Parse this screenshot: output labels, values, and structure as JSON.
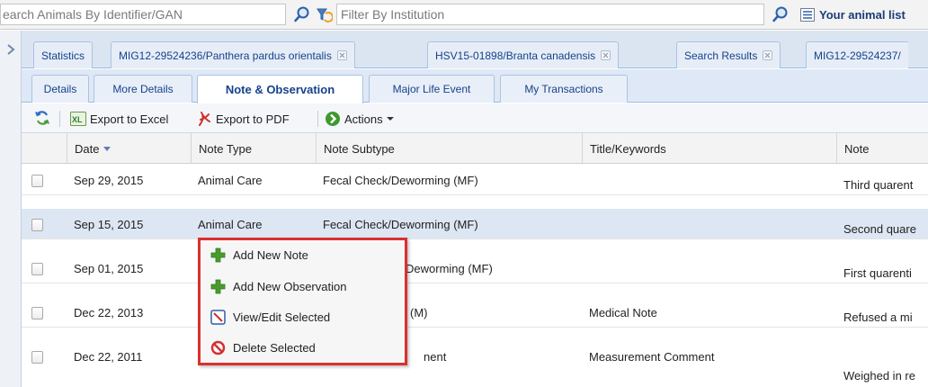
{
  "topbar": {
    "search_value": "earch Animals By Identifier/GAN",
    "filter_value": "Filter By Institution",
    "animal_list_label": "Your animal list"
  },
  "workspace_tabs": [
    {
      "label": "Statistics",
      "closable": false
    },
    {
      "label": "MIG12-29524236/Panthera pardus orientalis",
      "closable": true
    },
    {
      "label": "HSV15-01898/Branta canadensis",
      "closable": true
    },
    {
      "label": "Search Results",
      "closable": true
    },
    {
      "label": "MIG12-29524237/",
      "closable": false
    }
  ],
  "detail_tabs": [
    {
      "label": "Details",
      "active": false
    },
    {
      "label": "More Details",
      "active": false
    },
    {
      "label": "Note & Observation",
      "active": true
    },
    {
      "label": "Major Life Event",
      "active": false
    },
    {
      "label": "My Transactions",
      "active": false
    }
  ],
  "toolbar": {
    "export_excel": "Export to Excel",
    "export_pdf": "Export to PDF",
    "actions": "Actions"
  },
  "grid": {
    "columns": [
      "Date",
      "Note Type",
      "Note Subtype",
      "Title/Keywords",
      "Note"
    ],
    "rows": [
      {
        "date": "Sep 29, 2015",
        "type": "Animal Care",
        "subtype": "Fecal Check/Deworming (MF)",
        "title": "",
        "note": "Third quarent",
        "selected": false
      },
      {
        "date": "Sep 15, 2015",
        "type": "Animal Care",
        "subtype": "Fecal Check/Deworming (MF)",
        "title": "",
        "note": "Second quare",
        "selected": true
      },
      {
        "date": "Sep 01, 2015",
        "type": "",
        "subtype": "Deworming (MF)",
        "title": "",
        "note": "First quarenti",
        "selected": false
      },
      {
        "date": "Dec 22, 2013",
        "type": "",
        "subtype": "(M)",
        "title": "Medical Note",
        "note": "Refused a mi",
        "selected": false
      },
      {
        "date": "Dec 22, 2011",
        "type": "",
        "subtype": "nent",
        "title": "Measurement Comment",
        "note": "Weighed in re",
        "selected": false
      }
    ]
  },
  "context_menu": {
    "items": [
      {
        "label": "Add New Note",
        "icon": "plus-icon"
      },
      {
        "label": "Add New Observation",
        "icon": "plus-icon"
      },
      {
        "label": "View/Edit Selected",
        "icon": "edit-icon"
      },
      {
        "label": "Delete Selected",
        "icon": "delete-icon"
      }
    ]
  },
  "colors": {
    "tab_text": "#15428b",
    "menu_border": "#d9302e",
    "plus_icon": "#4a9b2f",
    "delete_icon": "#d32f2f",
    "selected_row": "#dde6f3"
  }
}
